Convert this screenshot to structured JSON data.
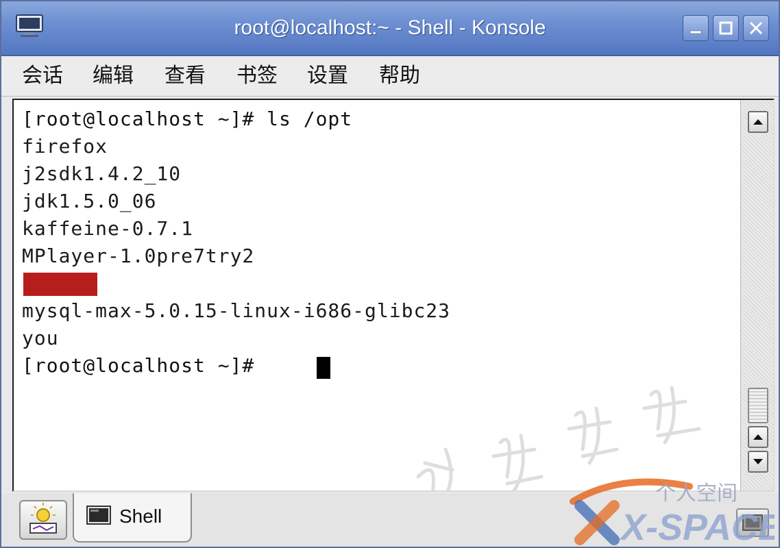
{
  "window": {
    "title": "root@localhost:~ - Shell - Konsole",
    "titlebar_color": "#6d8fd2",
    "controls": [
      "minimize-icon",
      "maximize-icon",
      "close-icon"
    ]
  },
  "menubar": {
    "items": [
      {
        "label": "会话"
      },
      {
        "label": "编辑"
      },
      {
        "label": "查看"
      },
      {
        "label": "书签"
      },
      {
        "label": "设置"
      },
      {
        "label": "帮助"
      }
    ]
  },
  "terminal": {
    "lines": [
      "[root@localhost ~]# ls /opt",
      "firefox",
      "j2sdk1.4.2_10",
      "jdk1.5.0_06",
      "kaffeine-0.7.1",
      "MPlayer-1.0pre7try2",
      "",
      "mysql-max-5.0.15-linux-i686-glibc23",
      "you",
      "[root@localhost ~]# "
    ],
    "redacted_color": "#b81d1d",
    "cursor_color": "#000000"
  },
  "tabbar": {
    "tabs": [
      {
        "label": "Shell",
        "icon": "terminal-icon"
      }
    ],
    "new_session_icon": "new-session-icon",
    "close_session_icon": "close-session-icon"
  },
  "watermark": {
    "logo_line1": "个人空间",
    "logo_line2": "X-SPACE"
  }
}
